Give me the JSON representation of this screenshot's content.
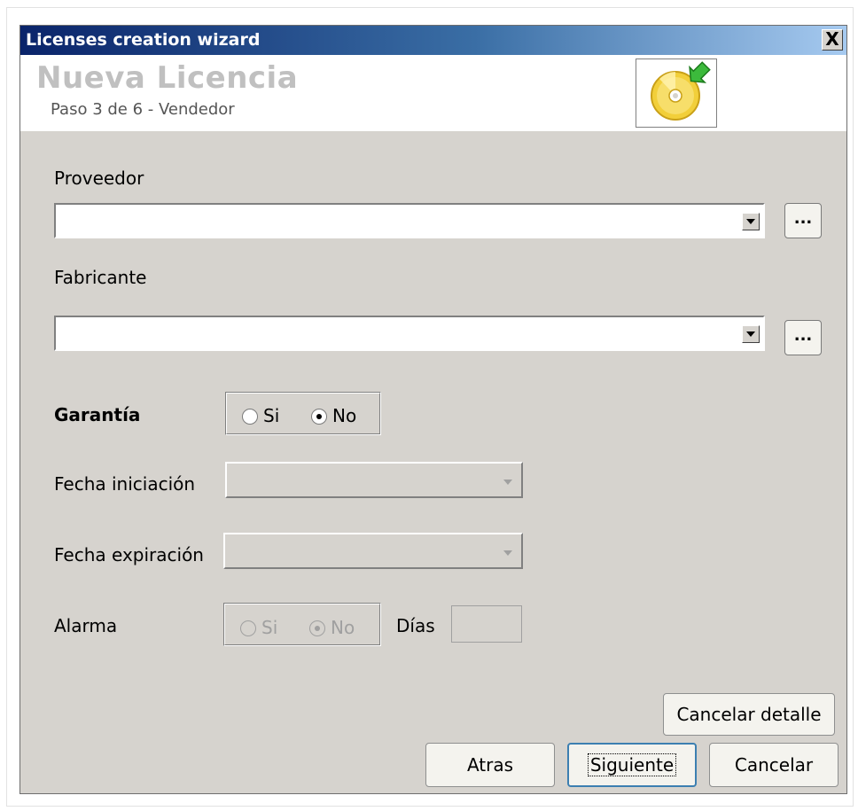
{
  "window": {
    "title": "Licenses creation wizard",
    "close_glyph": "X"
  },
  "header": {
    "title": "Nueva Licencia",
    "subtitle": "Paso 3 de 6 - Vendedor",
    "logo_icon": "cd-add-icon"
  },
  "fields": {
    "proveedor": {
      "label": "Proveedor",
      "value": "",
      "browse_label": "..."
    },
    "fabricante": {
      "label": "Fabricante",
      "value": "",
      "browse_label": "..."
    },
    "garantia": {
      "label": "Garantía",
      "option_si": "Si",
      "option_no": "No",
      "selected": "No"
    },
    "fecha_iniciacion": {
      "label": "Fecha iniciación",
      "value": ""
    },
    "fecha_expiracion": {
      "label": "Fecha expiración",
      "value": ""
    },
    "alarma": {
      "label": "Alarma",
      "option_si": "Si",
      "option_no": "No",
      "selected": "No",
      "dias_label": "Días",
      "dias_value": ""
    }
  },
  "buttons": {
    "cancelar_detalle": "Cancelar detalle",
    "atras": "Atras",
    "siguiente": "Siguiente",
    "cancelar": "Cancelar"
  },
  "colors": {
    "titlebar_start": "#0a246a",
    "titlebar_end": "#a6caf0",
    "dialog_bg": "#d6d3ce",
    "header_title": "#c0c0c0"
  }
}
